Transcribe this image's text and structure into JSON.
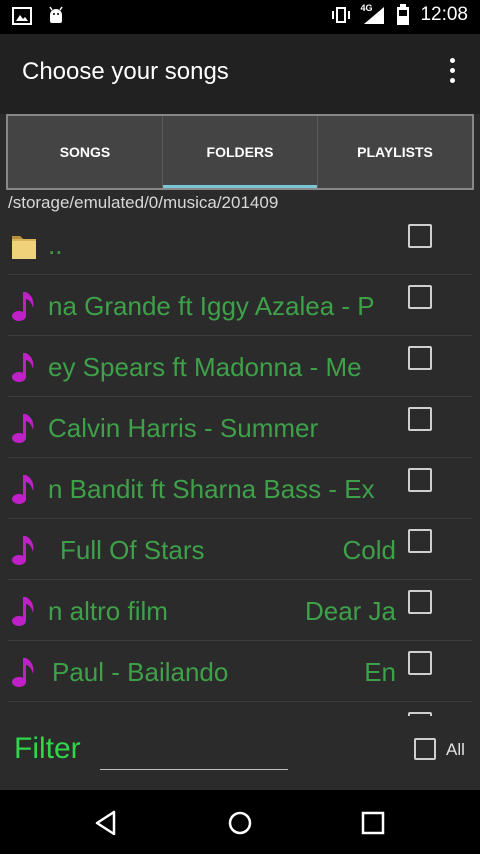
{
  "status_bar": {
    "time": "12:08",
    "network": "4G",
    "icons": [
      "image-icon",
      "android-debug-icon",
      "vibrate-icon",
      "signal-icon",
      "battery-icon"
    ]
  },
  "app_bar": {
    "title": "Choose your songs",
    "overflow_icon": "more-vert-icon"
  },
  "tabs": [
    {
      "label": "SONGS",
      "active": false
    },
    {
      "label": "FOLDERS",
      "active": true
    },
    {
      "label": "PLAYLISTS",
      "active": false
    }
  ],
  "path": "/storage/emulated/0/musica/201409",
  "rows": [
    {
      "type": "folder",
      "title": "..",
      "artist": ""
    },
    {
      "type": "song",
      "title": "na Grande ft Iggy Azalea - P",
      "artist": ""
    },
    {
      "type": "song",
      "title": "ey Spears ft Madonna - Me",
      "artist": ""
    },
    {
      "type": "song",
      "title": "Calvin Harris - Summer",
      "artist": ""
    },
    {
      "type": "song",
      "title": "n Bandit ft Sharna Bass - Ex",
      "artist": ""
    },
    {
      "type": "song",
      "title": "Full Of Stars",
      "artist": "Cold"
    },
    {
      "type": "song",
      "title": "n altro film",
      "artist": "Dear Ja"
    },
    {
      "type": "song",
      "title": "Paul - Bailando",
      "artist": "En"
    },
    {
      "type": "song",
      "title": "",
      "artist": ""
    }
  ],
  "filter": {
    "label": "Filter",
    "value": "",
    "all_label": "All"
  },
  "colors": {
    "song_text": "#3fa04a",
    "filter_label": "#2fd64a",
    "tab_indicator": "#79c6d6",
    "note_icon": "#c020c8"
  },
  "nav": [
    "back-icon",
    "home-icon",
    "recents-icon"
  ]
}
